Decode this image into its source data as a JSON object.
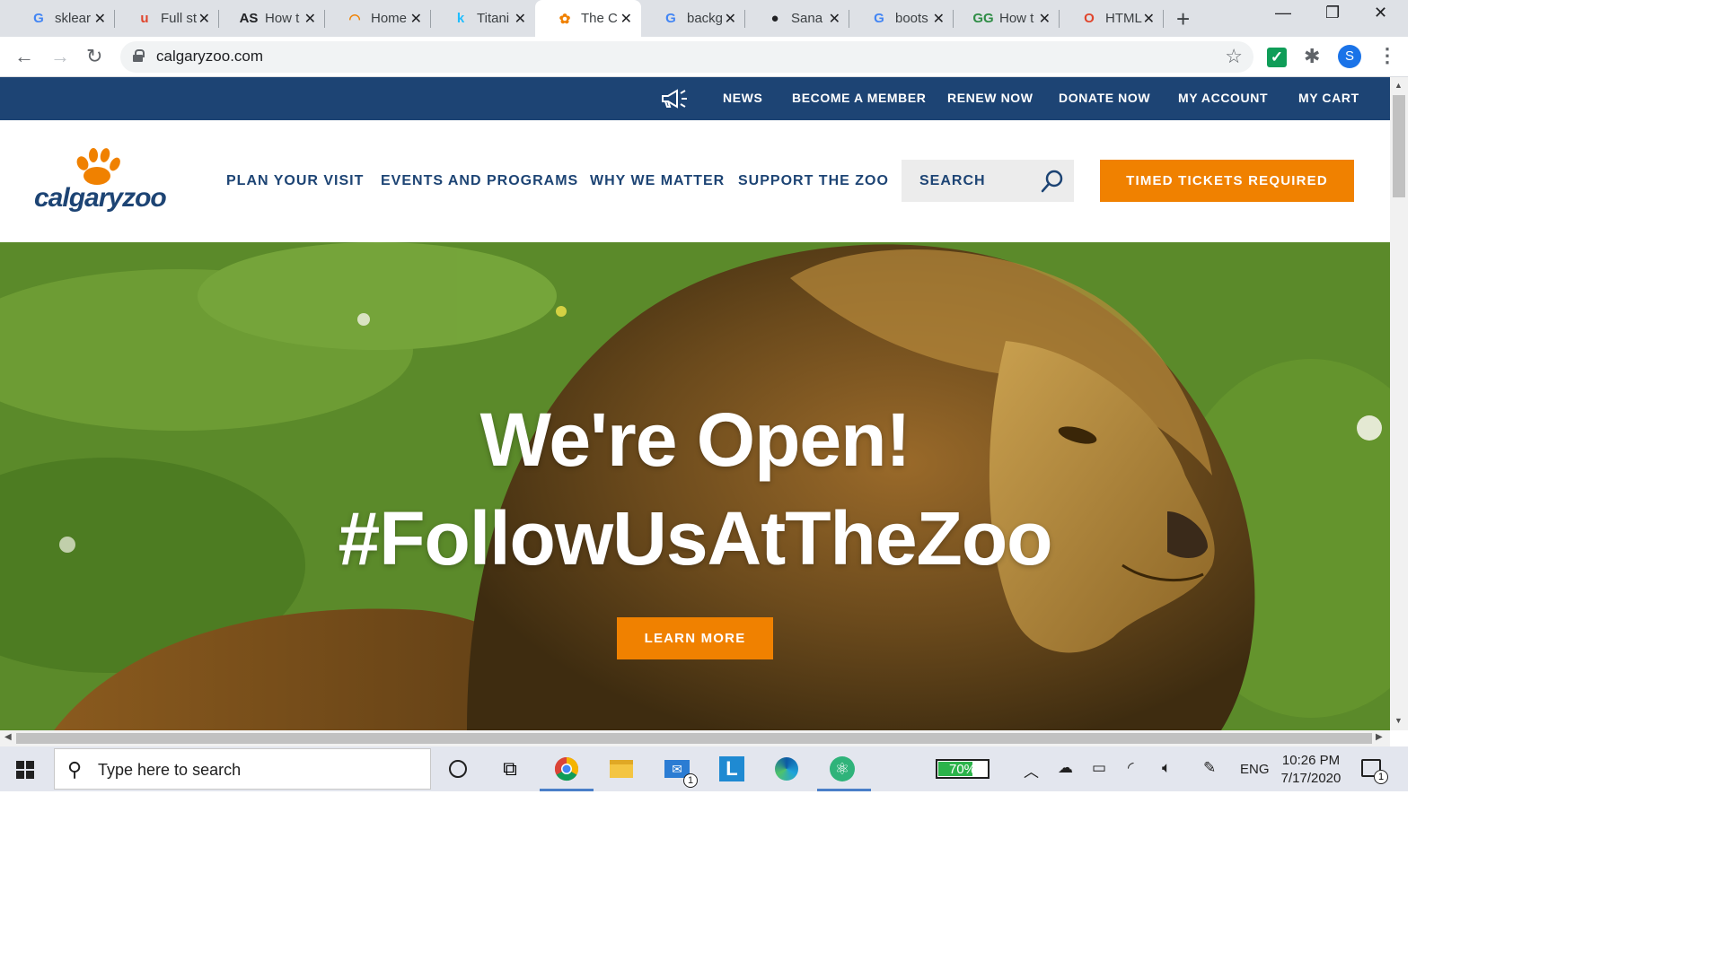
{
  "browser": {
    "tabs": [
      {
        "title": "sklear",
        "icon": "google-icon",
        "icon_glyph": "G",
        "icon_color": "#4285f4"
      },
      {
        "title": "Full st",
        "icon": "udemy-icon",
        "icon_glyph": "u",
        "icon_color": "#e0442b"
      },
      {
        "title": "How t",
        "icon": "analytics-steps-icon",
        "icon_glyph": "AS",
        "icon_color": "#202124"
      },
      {
        "title": "Home",
        "icon": "loader-ring-icon",
        "icon_glyph": "◠",
        "icon_color": "#f08100"
      },
      {
        "title": "Titani",
        "icon": "kaggle-icon",
        "icon_glyph": "k",
        "icon_color": "#20beff"
      },
      {
        "title": "The C",
        "icon": "paw-icon",
        "icon_glyph": "✿",
        "icon_color": "#f08100"
      },
      {
        "title": "backg",
        "icon": "google-icon",
        "icon_glyph": "G",
        "icon_color": "#4285f4"
      },
      {
        "title": "Sana",
        "icon": "github-icon",
        "icon_glyph": "●",
        "icon_color": "#202124"
      },
      {
        "title": "boots",
        "icon": "google-icon",
        "icon_glyph": "G",
        "icon_color": "#4285f4"
      },
      {
        "title": "How t",
        "icon": "gfg-icon",
        "icon_glyph": "GG",
        "icon_color": "#2f8d46"
      },
      {
        "title": "HTML",
        "icon": "opera-icon",
        "icon_glyph": "O",
        "icon_color": "#e0442b"
      }
    ],
    "active_tab": 5,
    "new_tab_glyph": "+",
    "url": "calgaryzoo.com",
    "profile_initial": "S"
  },
  "site": {
    "utility_nav": [
      "NEWS",
      "BECOME A MEMBER",
      "RENEW NOW",
      "DONATE NOW",
      "MY ACCOUNT",
      "MY CART"
    ],
    "logo_text": "calgaryzoo",
    "main_nav": [
      "PLAN YOUR VISIT",
      "EVENTS AND PROGRAMS",
      "WHY WE MATTER",
      "SUPPORT THE ZOO"
    ],
    "search_label": "SEARCH",
    "tickets_label": "TIMED TICKETS REQUIRED",
    "hero": {
      "line1": "We're Open!",
      "line2": "#FollowUsAtTheZoo",
      "cta": "LEARN MORE"
    },
    "colors": {
      "navy": "#1d4474",
      "orange": "#f08100"
    }
  },
  "taskbar": {
    "search_placeholder": "Type here to search",
    "battery_text": "70%",
    "battery_level": 0.7,
    "language": "ENG",
    "time": "10:26 PM",
    "date": "7/17/2020",
    "mail_badge": "1",
    "notification_badge": "1"
  }
}
